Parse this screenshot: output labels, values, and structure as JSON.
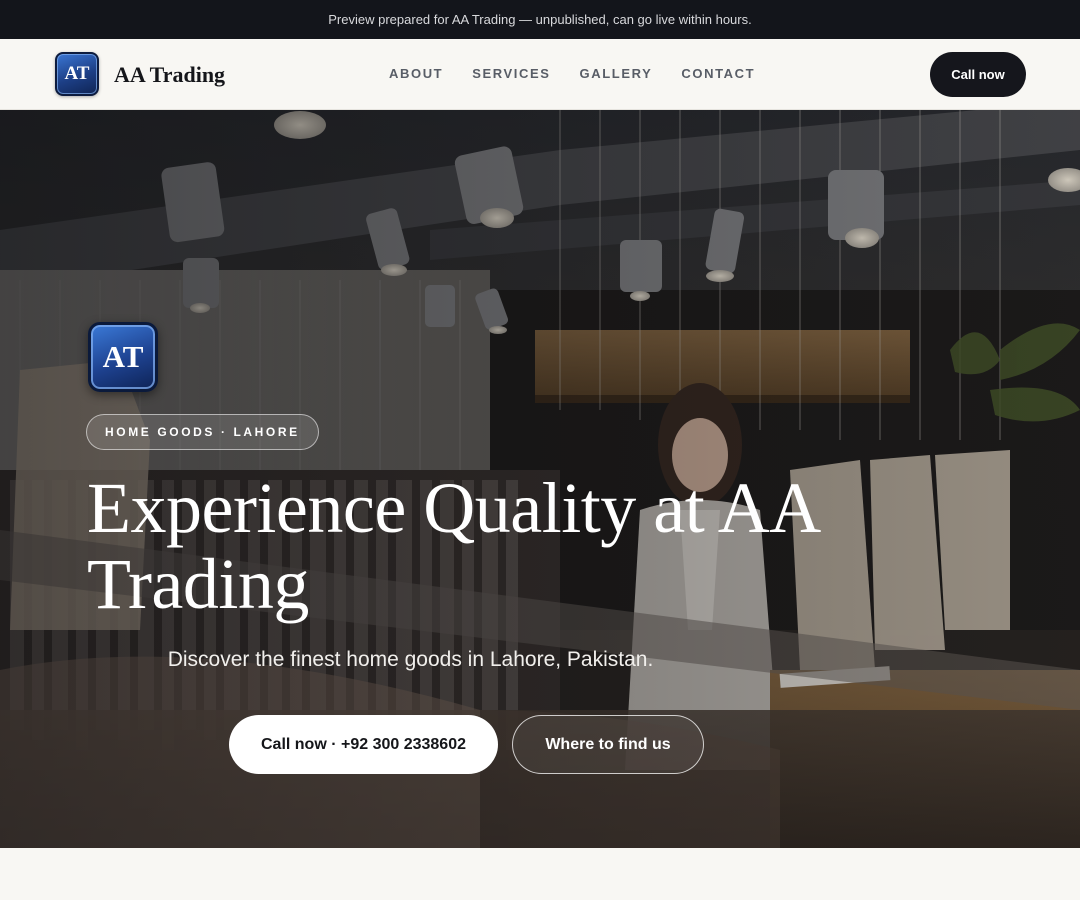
{
  "preview_bar": {
    "text": "Preview prepared for AA Trading — unpublished, can go live within hours."
  },
  "header": {
    "logo_initials": "AT",
    "brand_name": "AA Trading",
    "nav": [
      {
        "label": "ABOUT"
      },
      {
        "label": "SERVICES"
      },
      {
        "label": "GALLERY"
      },
      {
        "label": "CONTACT"
      }
    ],
    "cta_label": "Call now"
  },
  "hero": {
    "logo_initials": "AT",
    "tag": "HOME GOODS · LAHORE",
    "title": "Experience Quality at AA Trading",
    "subtitle": "Discover the finest home goods in Lahore, Pakistan.",
    "primary_button": "Call now · +92 300 2338602",
    "secondary_button": "Where to find us",
    "background_image": "clothing-store-interior"
  },
  "colors": {
    "dark": "#13151b",
    "page_bg": "#f8f7f3",
    "logo_blue": "#1e4290"
  }
}
